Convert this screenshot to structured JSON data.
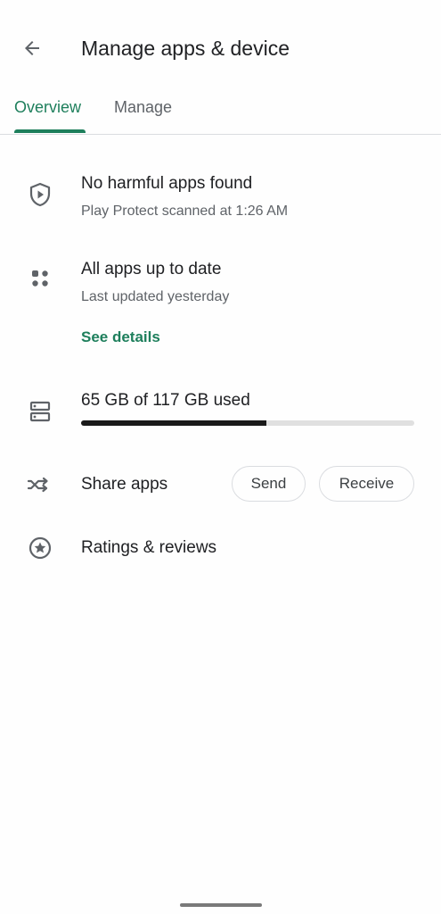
{
  "header": {
    "title": "Manage apps & device",
    "back_icon": "arrow-back-icon"
  },
  "tabs": [
    {
      "label": "Overview",
      "selected": true
    },
    {
      "label": "Manage",
      "selected": false
    }
  ],
  "colors": {
    "accent": "#1e7f5c",
    "text_primary": "#202124",
    "text_secondary": "#5f6368",
    "divider": "#dadce0"
  },
  "protect": {
    "icon": "shield-play-icon",
    "title": "No harmful apps found",
    "subtitle": "Play Protect scanned at 1:26 AM"
  },
  "updates": {
    "icon": "apps-grid-icon",
    "title": "All apps up to date",
    "subtitle": "Last updated yesterday",
    "link": "See details"
  },
  "storage": {
    "icon": "storage-icon",
    "label": "65 GB of 117 GB used",
    "used_fraction": 0.5556
  },
  "share": {
    "icon": "share-apps-icon",
    "label": "Share apps",
    "send_label": "Send",
    "receive_label": "Receive"
  },
  "ratings": {
    "icon": "star-circle-icon",
    "label": "Ratings & reviews"
  }
}
